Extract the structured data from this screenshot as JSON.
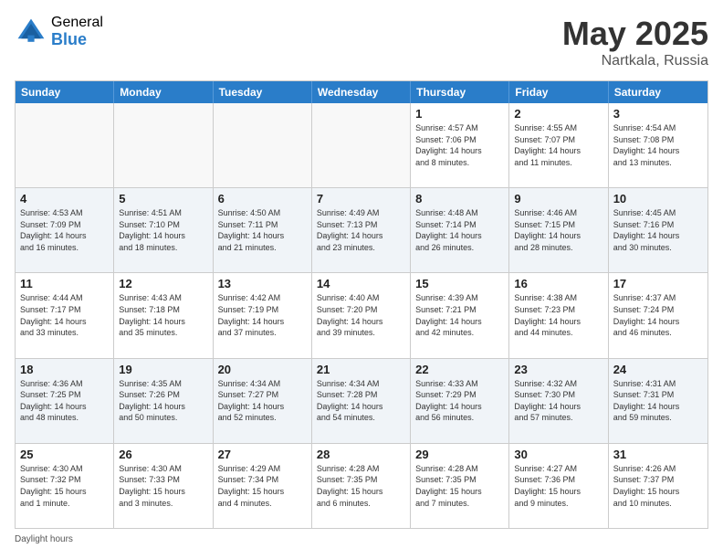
{
  "header": {
    "logo_general": "General",
    "logo_blue": "Blue",
    "title": "May 2025",
    "location": "Nartkala, Russia"
  },
  "weekdays": [
    "Sunday",
    "Monday",
    "Tuesday",
    "Wednesday",
    "Thursday",
    "Friday",
    "Saturday"
  ],
  "footer": {
    "daylight_label": "Daylight hours"
  },
  "rows": [
    {
      "alt": false,
      "cells": [
        {
          "day": "",
          "info": ""
        },
        {
          "day": "",
          "info": ""
        },
        {
          "day": "",
          "info": ""
        },
        {
          "day": "",
          "info": ""
        },
        {
          "day": "1",
          "info": "Sunrise: 4:57 AM\nSunset: 7:06 PM\nDaylight: 14 hours\nand 8 minutes."
        },
        {
          "day": "2",
          "info": "Sunrise: 4:55 AM\nSunset: 7:07 PM\nDaylight: 14 hours\nand 11 minutes."
        },
        {
          "day": "3",
          "info": "Sunrise: 4:54 AM\nSunset: 7:08 PM\nDaylight: 14 hours\nand 13 minutes."
        }
      ]
    },
    {
      "alt": true,
      "cells": [
        {
          "day": "4",
          "info": "Sunrise: 4:53 AM\nSunset: 7:09 PM\nDaylight: 14 hours\nand 16 minutes."
        },
        {
          "day": "5",
          "info": "Sunrise: 4:51 AM\nSunset: 7:10 PM\nDaylight: 14 hours\nand 18 minutes."
        },
        {
          "day": "6",
          "info": "Sunrise: 4:50 AM\nSunset: 7:11 PM\nDaylight: 14 hours\nand 21 minutes."
        },
        {
          "day": "7",
          "info": "Sunrise: 4:49 AM\nSunset: 7:13 PM\nDaylight: 14 hours\nand 23 minutes."
        },
        {
          "day": "8",
          "info": "Sunrise: 4:48 AM\nSunset: 7:14 PM\nDaylight: 14 hours\nand 26 minutes."
        },
        {
          "day": "9",
          "info": "Sunrise: 4:46 AM\nSunset: 7:15 PM\nDaylight: 14 hours\nand 28 minutes."
        },
        {
          "day": "10",
          "info": "Sunrise: 4:45 AM\nSunset: 7:16 PM\nDaylight: 14 hours\nand 30 minutes."
        }
      ]
    },
    {
      "alt": false,
      "cells": [
        {
          "day": "11",
          "info": "Sunrise: 4:44 AM\nSunset: 7:17 PM\nDaylight: 14 hours\nand 33 minutes."
        },
        {
          "day": "12",
          "info": "Sunrise: 4:43 AM\nSunset: 7:18 PM\nDaylight: 14 hours\nand 35 minutes."
        },
        {
          "day": "13",
          "info": "Sunrise: 4:42 AM\nSunset: 7:19 PM\nDaylight: 14 hours\nand 37 minutes."
        },
        {
          "day": "14",
          "info": "Sunrise: 4:40 AM\nSunset: 7:20 PM\nDaylight: 14 hours\nand 39 minutes."
        },
        {
          "day": "15",
          "info": "Sunrise: 4:39 AM\nSunset: 7:21 PM\nDaylight: 14 hours\nand 42 minutes."
        },
        {
          "day": "16",
          "info": "Sunrise: 4:38 AM\nSunset: 7:23 PM\nDaylight: 14 hours\nand 44 minutes."
        },
        {
          "day": "17",
          "info": "Sunrise: 4:37 AM\nSunset: 7:24 PM\nDaylight: 14 hours\nand 46 minutes."
        }
      ]
    },
    {
      "alt": true,
      "cells": [
        {
          "day": "18",
          "info": "Sunrise: 4:36 AM\nSunset: 7:25 PM\nDaylight: 14 hours\nand 48 minutes."
        },
        {
          "day": "19",
          "info": "Sunrise: 4:35 AM\nSunset: 7:26 PM\nDaylight: 14 hours\nand 50 minutes."
        },
        {
          "day": "20",
          "info": "Sunrise: 4:34 AM\nSunset: 7:27 PM\nDaylight: 14 hours\nand 52 minutes."
        },
        {
          "day": "21",
          "info": "Sunrise: 4:34 AM\nSunset: 7:28 PM\nDaylight: 14 hours\nand 54 minutes."
        },
        {
          "day": "22",
          "info": "Sunrise: 4:33 AM\nSunset: 7:29 PM\nDaylight: 14 hours\nand 56 minutes."
        },
        {
          "day": "23",
          "info": "Sunrise: 4:32 AM\nSunset: 7:30 PM\nDaylight: 14 hours\nand 57 minutes."
        },
        {
          "day": "24",
          "info": "Sunrise: 4:31 AM\nSunset: 7:31 PM\nDaylight: 14 hours\nand 59 minutes."
        }
      ]
    },
    {
      "alt": false,
      "cells": [
        {
          "day": "25",
          "info": "Sunrise: 4:30 AM\nSunset: 7:32 PM\nDaylight: 15 hours\nand 1 minute."
        },
        {
          "day": "26",
          "info": "Sunrise: 4:30 AM\nSunset: 7:33 PM\nDaylight: 15 hours\nand 3 minutes."
        },
        {
          "day": "27",
          "info": "Sunrise: 4:29 AM\nSunset: 7:34 PM\nDaylight: 15 hours\nand 4 minutes."
        },
        {
          "day": "28",
          "info": "Sunrise: 4:28 AM\nSunset: 7:35 PM\nDaylight: 15 hours\nand 6 minutes."
        },
        {
          "day": "29",
          "info": "Sunrise: 4:28 AM\nSunset: 7:35 PM\nDaylight: 15 hours\nand 7 minutes."
        },
        {
          "day": "30",
          "info": "Sunrise: 4:27 AM\nSunset: 7:36 PM\nDaylight: 15 hours\nand 9 minutes."
        },
        {
          "day": "31",
          "info": "Sunrise: 4:26 AM\nSunset: 7:37 PM\nDaylight: 15 hours\nand 10 minutes."
        }
      ]
    }
  ]
}
